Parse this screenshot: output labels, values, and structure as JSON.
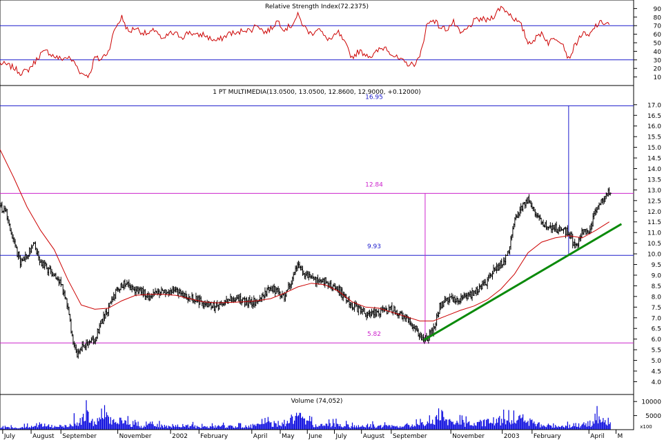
{
  "rsi": {
    "title": "Relative Strength Index(72.2375)",
    "yticks": [
      10,
      20,
      30,
      40,
      50,
      60,
      70,
      80,
      90
    ],
    "ylim": [
      0,
      100
    ],
    "levels": [
      30,
      70
    ],
    "points": [
      [
        0,
        26
      ],
      [
        0.5,
        24
      ],
      [
        1,
        21
      ],
      [
        1.5,
        15
      ],
      [
        2,
        17
      ],
      [
        2.5,
        26
      ],
      [
        3,
        37
      ],
      [
        3.5,
        40
      ],
      [
        4,
        34
      ],
      [
        4.5,
        31
      ],
      [
        5,
        33
      ],
      [
        5.5,
        27
      ],
      [
        6,
        14
      ],
      [
        6.6,
        12
      ],
      [
        7,
        33
      ],
      [
        7.4,
        30
      ],
      [
        8,
        40
      ],
      [
        8.5,
        67
      ],
      [
        9,
        80
      ],
      [
        9.5,
        62
      ],
      [
        10,
        68
      ],
      [
        10.5,
        62
      ],
      [
        11,
        60
      ],
      [
        11.5,
        66
      ],
      [
        12,
        52
      ],
      [
        12.5,
        61
      ],
      [
        13,
        60
      ],
      [
        13.5,
        57
      ],
      [
        14,
        63
      ],
      [
        14.5,
        58
      ],
      [
        15,
        60
      ],
      [
        15.5,
        55
      ],
      [
        16,
        52
      ],
      [
        16.5,
        56
      ],
      [
        17,
        62
      ],
      [
        17.5,
        60
      ],
      [
        18,
        66
      ],
      [
        18.5,
        64
      ],
      [
        19,
        72
      ],
      [
        19.5,
        62
      ],
      [
        20,
        66
      ],
      [
        20.5,
        76
      ],
      [
        21,
        66
      ],
      [
        21.5,
        70
      ],
      [
        22,
        82
      ],
      [
        22.5,
        68
      ],
      [
        23,
        60
      ],
      [
        23.5,
        68
      ],
      [
        24,
        56
      ],
      [
        24.5,
        54
      ],
      [
        25,
        62
      ],
      [
        25.5,
        48
      ],
      [
        26,
        33
      ],
      [
        26.5,
        40
      ],
      [
        27,
        37
      ],
      [
        27.5,
        34
      ],
      [
        28,
        42
      ],
      [
        28.5,
        45
      ],
      [
        29,
        36
      ],
      [
        29.5,
        30
      ],
      [
        30,
        26
      ],
      [
        30.5,
        24
      ],
      [
        31,
        32
      ],
      [
        31.5,
        70
      ],
      [
        32,
        78
      ],
      [
        32.5,
        68
      ],
      [
        33,
        66
      ],
      [
        33.5,
        74
      ],
      [
        34,
        60
      ],
      [
        34.5,
        66
      ],
      [
        35,
        75
      ],
      [
        35.5,
        78
      ],
      [
        36,
        76
      ],
      [
        36.5,
        82
      ],
      [
        37,
        92
      ],
      [
        37.5,
        86
      ],
      [
        38,
        78
      ],
      [
        38.5,
        70
      ],
      [
        39,
        50
      ],
      [
        39.5,
        54
      ],
      [
        40,
        62
      ],
      [
        40.5,
        50
      ],
      [
        41,
        56
      ],
      [
        41.5,
        52
      ],
      [
        42,
        31
      ],
      [
        42.5,
        48
      ],
      [
        43,
        61
      ],
      [
        43.5,
        57
      ],
      [
        44,
        70
      ],
      [
        44.5,
        74
      ],
      [
        45,
        72
      ]
    ]
  },
  "price": {
    "title": "1 PT MULTIMEDIA(13.0500, 13.0500, 12.8600, 12.9000, +0.12000)",
    "yticks": [
      4.0,
      4.5,
      5.0,
      5.5,
      6.0,
      6.5,
      7.0,
      7.5,
      8.0,
      8.5,
      9.0,
      9.5,
      10.0,
      10.5,
      11.0,
      11.5,
      12.0,
      12.5,
      13.0,
      13.5,
      14.0,
      14.5,
      15.0,
      15.5,
      16.0,
      16.5,
      17.0
    ],
    "ytick_labels": [
      "4.0",
      "4.5",
      "5.0",
      "5.5",
      "6.0",
      "6.5",
      "7.0",
      "7.5",
      "8.0",
      "8.5",
      "9.0",
      "9.5",
      "10.0",
      "10.5",
      "11.0",
      "11.5",
      "12.0",
      "12.5",
      "13.0",
      "13.5",
      "14.0",
      "14.5",
      "15.0",
      "15.5",
      "16.0",
      "16.5",
      "17.0"
    ],
    "ylim": [
      3.4,
      17.9
    ],
    "levels": [
      {
        "value": 16.95,
        "label": "16.95",
        "color": "#1a1acc"
      },
      {
        "value": 12.84,
        "label": "12.84",
        "color": "#cc22cc"
      },
      {
        "value": 9.93,
        "label": "9.93",
        "color": "#1a1acc"
      },
      {
        "value": 5.82,
        "label": "5.82",
        "color": "#cc22cc"
      }
    ],
    "close": [
      [
        0,
        12.2
      ],
      [
        0.5,
        11.9
      ],
      [
        1,
        10.6
      ],
      [
        1.5,
        9.6
      ],
      [
        2,
        9.9
      ],
      [
        2.5,
        10.5
      ],
      [
        3,
        9.6
      ],
      [
        3.5,
        9.3
      ],
      [
        4,
        9.1
      ],
      [
        4.5,
        8.6
      ],
      [
        5,
        7.6
      ],
      [
        5.3,
        6.2
      ],
      [
        5.7,
        5.3
      ],
      [
        6,
        5.6
      ],
      [
        6.5,
        5.7
      ],
      [
        7,
        6.0
      ],
      [
        7.5,
        6.8
      ],
      [
        8,
        7.4
      ],
      [
        8.5,
        8.1
      ],
      [
        9,
        8.6
      ],
      [
        9.5,
        8.5
      ],
      [
        10,
        8.3
      ],
      [
        10.5,
        8.2
      ],
      [
        11,
        8.0
      ],
      [
        12,
        8.3
      ],
      [
        13,
        8.2
      ],
      [
        14,
        8.0
      ],
      [
        15,
        7.7
      ],
      [
        16,
        7.5
      ],
      [
        17,
        7.9
      ],
      [
        18,
        7.8
      ],
      [
        19,
        7.7
      ],
      [
        20,
        8.4
      ],
      [
        21,
        8.0
      ],
      [
        22,
        9.4
      ],
      [
        22.5,
        9.1
      ],
      [
        23,
        8.8
      ],
      [
        24,
        8.7
      ],
      [
        25,
        8.3
      ],
      [
        26,
        7.6
      ],
      [
        27,
        7.2
      ],
      [
        28,
        7.3
      ],
      [
        29,
        7.4
      ],
      [
        30,
        7.0
      ],
      [
        30.5,
        6.6
      ],
      [
        31,
        6.1
      ],
      [
        31.5,
        6.0
      ],
      [
        32,
        6.4
      ],
      [
        32.5,
        7.6
      ],
      [
        33,
        7.9
      ],
      [
        34,
        7.8
      ],
      [
        35,
        8.2
      ],
      [
        36,
        8.7
      ],
      [
        36.5,
        9.3
      ],
      [
        37,
        9.5
      ],
      [
        37.5,
        10.0
      ],
      [
        38,
        11.5
      ],
      [
        38.5,
        12.2
      ],
      [
        39,
        12.6
      ],
      [
        39.5,
        12.0
      ],
      [
        40,
        11.4
      ],
      [
        41,
        11.2
      ],
      [
        42,
        11.0
      ],
      [
        42.5,
        10.3
      ],
      [
        43,
        11.0
      ],
      [
        43.5,
        11.0
      ],
      [
        44,
        12.0
      ],
      [
        44.5,
        12.5
      ],
      [
        45,
        12.9
      ]
    ],
    "ma": [
      [
        0,
        14.9
      ],
      [
        1,
        13.6
      ],
      [
        2,
        12.2
      ],
      [
        3,
        11.1
      ],
      [
        4,
        10.2
      ],
      [
        5,
        8.8
      ],
      [
        6,
        7.6
      ],
      [
        7,
        7.4
      ],
      [
        8,
        7.45
      ],
      [
        9,
        7.8
      ],
      [
        10,
        8.05
      ],
      [
        11,
        8.1
      ],
      [
        12,
        8.1
      ],
      [
        13,
        8.05
      ],
      [
        14,
        7.9
      ],
      [
        15,
        7.75
      ],
      [
        16,
        7.7
      ],
      [
        17,
        7.72
      ],
      [
        18,
        7.75
      ],
      [
        19,
        7.8
      ],
      [
        20,
        7.9
      ],
      [
        21,
        8.15
      ],
      [
        22,
        8.45
      ],
      [
        23,
        8.62
      ],
      [
        24,
        8.55
      ],
      [
        25,
        8.25
      ],
      [
        26,
        7.75
      ],
      [
        27,
        7.5
      ],
      [
        28,
        7.45
      ],
      [
        29,
        7.25
      ],
      [
        30,
        7.05
      ],
      [
        31,
        6.85
      ],
      [
        32,
        6.85
      ],
      [
        33,
        7.1
      ],
      [
        34,
        7.35
      ],
      [
        35,
        7.55
      ],
      [
        36,
        7.85
      ],
      [
        37,
        8.35
      ],
      [
        38,
        9.05
      ],
      [
        39,
        10.05
      ],
      [
        40,
        10.55
      ],
      [
        41,
        10.75
      ],
      [
        42,
        10.85
      ],
      [
        43,
        10.75
      ],
      [
        44,
        11.1
      ],
      [
        45,
        11.5
      ]
    ],
    "trendline": {
      "from": [
        31.3,
        5.95
      ],
      "to": [
        45.9,
        11.4
      ]
    },
    "markers": [
      {
        "x": 31.4,
        "from": 5.82,
        "to": 12.84,
        "color": "#cc22cc"
      },
      {
        "x": 42.0,
        "from": 10.0,
        "to": 16.95,
        "color": "#1a1acc"
      }
    ]
  },
  "volume": {
    "title": "Volume (74,052)",
    "yticks": [
      5000,
      10000
    ],
    "ytick_labels": [
      "5000",
      "10000"
    ],
    "multiplier": "x100",
    "ylim": [
      0,
      12500
    ],
    "peaks": [
      [
        0,
        1200
      ],
      [
        2,
        2200
      ],
      [
        3,
        4000
      ],
      [
        4,
        2400
      ],
      [
        5,
        3000
      ],
      [
        5.5,
        6000
      ],
      [
        6,
        3800
      ],
      [
        6.2,
        12000
      ],
      [
        7,
        5000
      ],
      [
        7.7,
        8500
      ],
      [
        8,
        11000
      ],
      [
        8.5,
        4200
      ],
      [
        9,
        7000
      ],
      [
        9.5,
        4600
      ],
      [
        10,
        5200
      ],
      [
        10.5,
        3000
      ],
      [
        11,
        6000
      ],
      [
        11.5,
        3200
      ],
      [
        13,
        2800
      ],
      [
        14,
        3000
      ],
      [
        15,
        2000
      ],
      [
        16,
        2400
      ],
      [
        17,
        2600
      ],
      [
        18,
        2200
      ],
      [
        19,
        3300
      ],
      [
        20,
        4800
      ],
      [
        21,
        5500
      ],
      [
        22,
        10500
      ],
      [
        22.5,
        5800
      ],
      [
        23,
        4600
      ],
      [
        24,
        3500
      ],
      [
        25,
        4000
      ],
      [
        26,
        2500
      ],
      [
        27,
        3200
      ],
      [
        28,
        2800
      ],
      [
        29,
        2400
      ],
      [
        30,
        3300
      ],
      [
        31,
        3800
      ],
      [
        31.5,
        4200
      ],
      [
        32,
        6200
      ],
      [
        32.5,
        12000
      ],
      [
        33,
        5800
      ],
      [
        34,
        5200
      ],
      [
        35,
        4100
      ],
      [
        36,
        6000
      ],
      [
        37,
        7200
      ],
      [
        38,
        6800
      ],
      [
        38.5,
        8800
      ],
      [
        39,
        7000
      ],
      [
        40,
        3200
      ],
      [
        41,
        3400
      ],
      [
        42,
        2800
      ],
      [
        42.5,
        4100
      ],
      [
        43,
        3500
      ],
      [
        44,
        5800
      ],
      [
        44.2,
        11000
      ],
      [
        44.5,
        6000
      ],
      [
        45,
        7000
      ]
    ]
  },
  "xaxis": {
    "xlim": [
      0,
      46.8
    ],
    "months": [
      {
        "label": "July",
        "x": 0.3
      },
      {
        "label": "August",
        "x": 2.4
      },
      {
        "label": "September",
        "x": 4.6
      },
      {
        "label": "November",
        "x": 8.8
      },
      {
        "label": "2002",
        "x": 12.7
      },
      {
        "label": "February",
        "x": 14.8
      },
      {
        "label": "April",
        "x": 18.7
      },
      {
        "label": "May",
        "x": 20.8
      },
      {
        "label": "June",
        "x": 22.8
      },
      {
        "label": "July",
        "x": 24.8
      },
      {
        "label": "August",
        "x": 26.8
      },
      {
        "label": "September",
        "x": 29.0
      },
      {
        "label": "November",
        "x": 33.4
      },
      {
        "label": "2003",
        "x": 37.2
      },
      {
        "label": "February",
        "x": 39.4
      },
      {
        "label": "April",
        "x": 43.6
      },
      {
        "label": "M",
        "x": 45.6
      }
    ]
  },
  "colors": {
    "price": "#000000",
    "ma": "#cc0000",
    "rsi": "#cc0000",
    "trend": "#0a8a0a",
    "volume": "#0000dd",
    "frame": "#000000",
    "grid": "#c8c8c8"
  }
}
